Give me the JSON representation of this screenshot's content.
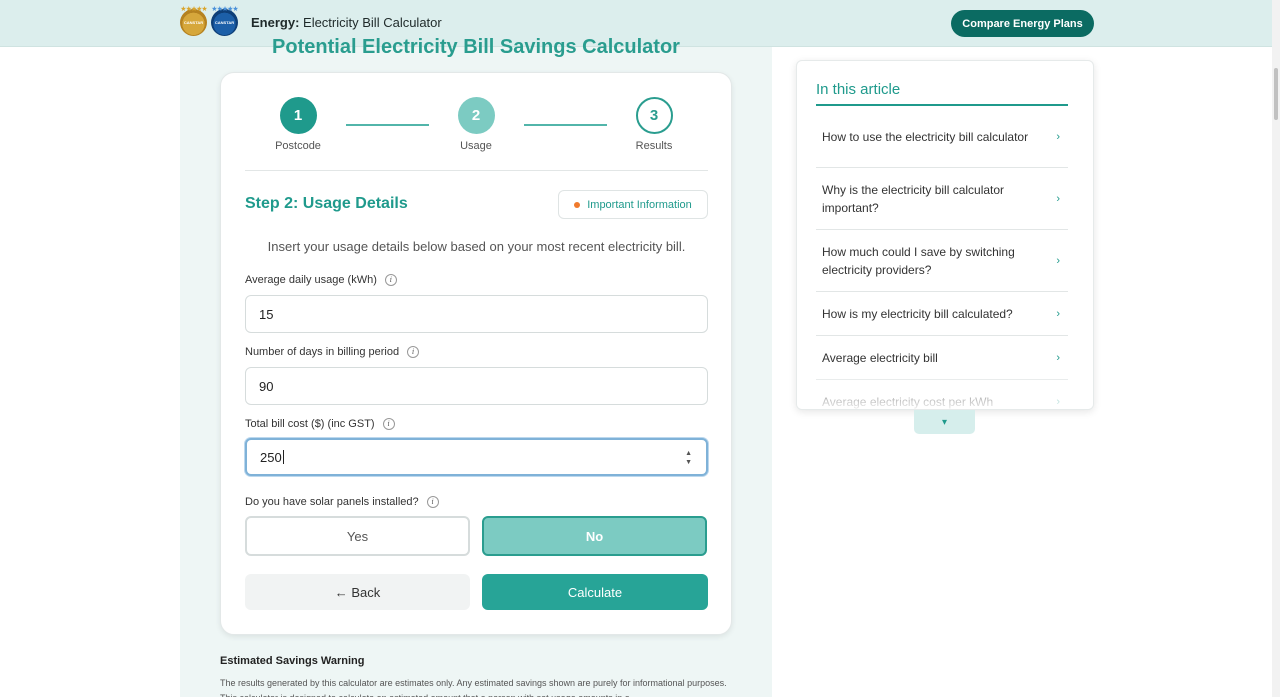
{
  "header": {
    "logos": [
      {
        "name": "canstar-gold-award",
        "label": "CANSTAR",
        "stars": "★★★★★"
      },
      {
        "name": "canstar-blue-award",
        "label": "CANSTAR",
        "stars": "★★★★★"
      }
    ],
    "heading_bold": "Energy:",
    "heading_rest": " Electricity Bill Calculator",
    "compare_button": "Compare Energy Plans"
  },
  "calculator": {
    "title": "Potential Electricity Bill Savings Calculator",
    "steps": [
      {
        "number": "1",
        "label": "Postcode"
      },
      {
        "number": "2",
        "label": "Usage"
      },
      {
        "number": "3",
        "label": "Results"
      }
    ],
    "step_title": "Step 2: Usage Details",
    "important_info": "Important Information",
    "intro": "Insert your usage details below based on your most recent electricity bill.",
    "fields": [
      {
        "label": "Average daily usage (kWh)",
        "value": "15"
      },
      {
        "label": "Number of days in billing period",
        "value": "90"
      },
      {
        "label": "Total bill cost ($) (inc GST)",
        "value": "250"
      }
    ],
    "solar_question": "Do you have solar panels installed?",
    "solar_options": {
      "yes": "Yes",
      "no": "No",
      "selected": "No"
    },
    "back_button": "← Back",
    "calculate_button": "Calculate"
  },
  "warning": {
    "title": "Estimated Savings Warning",
    "text": "The results generated by this calculator are estimates only. Any estimated savings shown are purely for informational purposes. This calculator is designed to calculate an estimated amount that a person with set usage amounts in a"
  },
  "toc": {
    "title": "In this article",
    "items": [
      "How to use the electricity bill calculator",
      "Why is the electricity bill calculator important?",
      "How much could I save by switching electricity providers?",
      "How is my electricity bill calculated?",
      "Average electricity bill",
      "Average electricity cost per kWh"
    ]
  },
  "colors": {
    "brand": "#1f9a8c",
    "header_bg": "#dceeed",
    "compare_button": "#0b6b62",
    "warning_dot": "#f07a2c"
  }
}
